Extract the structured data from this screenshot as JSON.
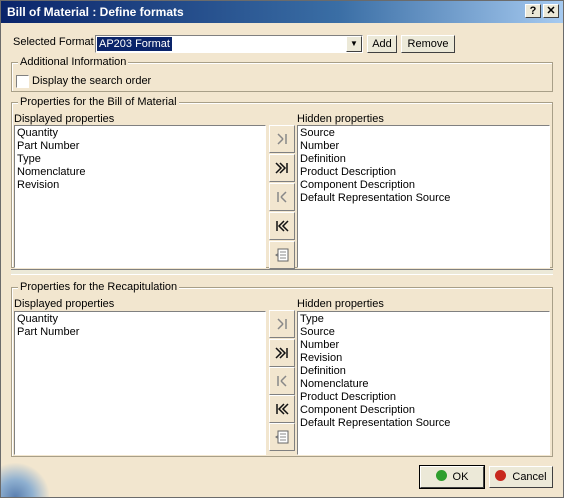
{
  "window": {
    "title": "Bill of Material : Define formats",
    "help_label": "?",
    "close_label": "✕"
  },
  "format": {
    "label": "Selected Format",
    "selected": "AP203 Format",
    "add_label": "Add",
    "remove_label": "Remove"
  },
  "additional": {
    "title": "Additional Information",
    "checkbox_label": "Display the search order",
    "checked": false
  },
  "bom": {
    "title": "Properties for the Bill of Material",
    "displayed_label": "Displayed properties",
    "hidden_label": "Hidden properties",
    "displayed": [
      "Quantity",
      "Part Number",
      "Type",
      "Nomenclature",
      "Revision"
    ],
    "hidden": [
      "Source",
      "Number",
      "Definition",
      "Product Description",
      "Component Description",
      "Default Representation Source"
    ]
  },
  "recap": {
    "title": "Properties for the Recapitulation",
    "displayed_label": "Displayed properties",
    "hidden_label": "Hidden properties",
    "displayed": [
      "Quantity",
      "Part Number"
    ],
    "hidden": [
      "Type",
      "Source",
      "Number",
      "Revision",
      "Definition",
      "Nomenclature",
      "Product Description",
      "Component Description",
      "Default Representation Source"
    ]
  },
  "icons": {
    "move_right": "move-right-icon",
    "move_all_right": "move-all-right-icon",
    "move_left": "move-left-icon",
    "move_all_left": "move-all-left-icon",
    "reorder": "reorder-icon"
  },
  "footer": {
    "ok_label": "OK",
    "cancel_label": "Cancel",
    "ok_color": "#2e9e2e",
    "cancel_color": "#c8281e"
  },
  "colors": {
    "title_start": "#0a246a",
    "dialog_bg": "#f2e6cf"
  }
}
